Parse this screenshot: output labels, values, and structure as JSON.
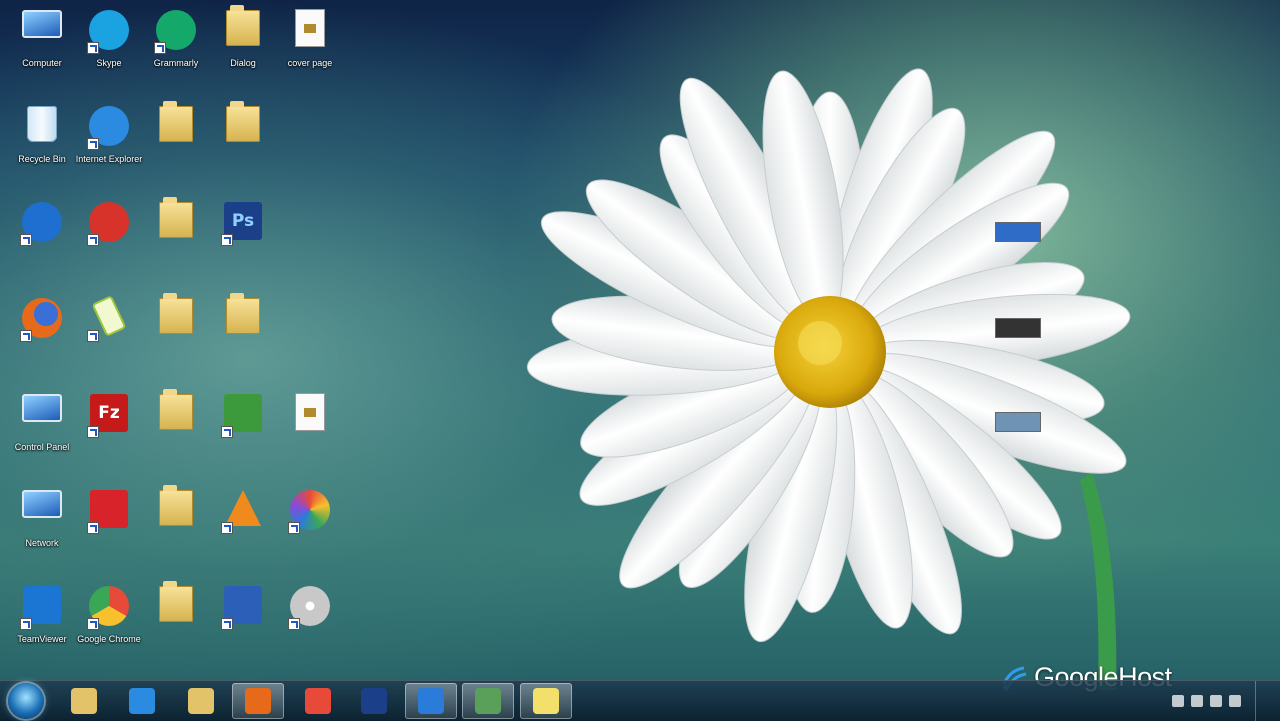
{
  "desktop_icons": [
    {
      "key": "computer",
      "label": "Computer",
      "glyph": "computer-icon",
      "color": "#2b7bd8"
    },
    {
      "key": "skype",
      "label": "Skype",
      "glyph": "skype-icon",
      "color": "#1aa3e0"
    },
    {
      "key": "grammarly",
      "label": "Grammarly",
      "glyph": "grammarly-icon",
      "color": "#14a86a"
    },
    {
      "key": "dialog",
      "label": "Dialog",
      "glyph": "folder-icon",
      "color": "#e2c36a"
    },
    {
      "key": "cover-page",
      "label": "cover page",
      "glyph": "document-icon",
      "color": "#f4f4f4"
    },
    {
      "key": "recycle-bin",
      "label": "Recycle Bin",
      "glyph": "recycle-bin-icon",
      "color": "#cfe6f5"
    },
    {
      "key": "ie-alt",
      "label": "Internet Explorer",
      "glyph": "ie-icon",
      "color": "#2a8be0"
    },
    {
      "key": "folder-b",
      "label": "",
      "glyph": "folder-icon",
      "color": "#e2c36a"
    },
    {
      "key": "folder-c",
      "label": "",
      "glyph": "folder-icon",
      "color": "#e2c36a"
    },
    {
      "key": "thunder",
      "label": "",
      "glyph": "lightning-icon",
      "color": "#1f6fd0"
    },
    {
      "key": "ccleaner",
      "label": "",
      "glyph": "ccleaner-icon",
      "color": "#d8332a"
    },
    {
      "key": "folder-d",
      "label": "",
      "glyph": "folder-icon",
      "color": "#e2c36a"
    },
    {
      "key": "photoshop",
      "label": "",
      "glyph": "photoshop-icon",
      "color": "#1c3f8a"
    },
    {
      "key": "firefox",
      "label": "",
      "glyph": "firefox-icon",
      "color": "#e66a1a"
    },
    {
      "key": "phone-app",
      "label": "",
      "glyph": "phone-icon",
      "color": "#9bc53d"
    },
    {
      "key": "folder-e",
      "label": "",
      "glyph": "folder-icon",
      "color": "#e2c36a"
    },
    {
      "key": "folder-f",
      "label": "",
      "glyph": "folder-icon",
      "color": "#e2c36a"
    },
    {
      "key": "control-panel",
      "label": "Control Panel",
      "glyph": "control-panel-icon",
      "color": "#4da6e8"
    },
    {
      "key": "filezilla",
      "label": "",
      "glyph": "filezilla-icon",
      "color": "#c41a1a"
    },
    {
      "key": "folder-g",
      "label": "",
      "glyph": "folder-icon",
      "color": "#e2c36a"
    },
    {
      "key": "spreadsheet",
      "label": "",
      "glyph": "spreadsheet-icon",
      "color": "#3c9a3c"
    },
    {
      "key": "doc-b",
      "label": "",
      "glyph": "document-icon",
      "color": "#f4f4f4"
    },
    {
      "key": "network",
      "label": "Network",
      "glyph": "network-icon",
      "color": "#2b7bd8"
    },
    {
      "key": "ftp-app",
      "label": "",
      "glyph": "ftp-app-icon",
      "color": "#d8232a"
    },
    {
      "key": "folder-h",
      "label": "",
      "glyph": "folder-icon",
      "color": "#e2c36a"
    },
    {
      "key": "vlc",
      "label": "",
      "glyph": "vlc-icon",
      "color": "#f08a1c"
    },
    {
      "key": "picasa",
      "label": "",
      "glyph": "picasa-icon",
      "color": "#8a4bd8"
    },
    {
      "key": "teamviewer",
      "label": "TeamViewer",
      "glyph": "teamviewer-icon",
      "color": "#1a76d2"
    },
    {
      "key": "chrome",
      "label": "Google Chrome",
      "glyph": "chrome-icon",
      "color": "#e84a3a"
    },
    {
      "key": "folder-i",
      "label": "",
      "glyph": "folder-icon",
      "color": "#e2c36a"
    },
    {
      "key": "app-blue",
      "label": "",
      "glyph": "app-icon",
      "color": "#2b5fb8"
    },
    {
      "key": "app-disk",
      "label": "",
      "glyph": "disk-icon",
      "color": "#d9d9d9"
    }
  ],
  "right_files": [
    {
      "key": "rf1",
      "label": "",
      "thumb": "#2e6cc8"
    },
    {
      "key": "rf2",
      "label": "",
      "thumb": "#333333"
    },
    {
      "key": "rf3",
      "label": "",
      "thumb": "#6f93b5"
    }
  ],
  "watermark": {
    "text": "GoogleHost"
  },
  "taskbar": {
    "apps": [
      {
        "key": "start",
        "label": "",
        "icon": "start-icon",
        "color": "#1a6fb6"
      },
      {
        "key": "library",
        "label": "",
        "icon": "library-icon",
        "color": "#e2c36a"
      },
      {
        "key": "internet-explorer",
        "label": "",
        "icon": "ie-icon",
        "color": "#2a8be0"
      },
      {
        "key": "explorer",
        "label": "",
        "icon": "folder-icon",
        "color": "#e2c36a"
      },
      {
        "key": "firefox",
        "label": "",
        "icon": "firefox-icon",
        "color": "#e66a1a"
      },
      {
        "key": "chrome",
        "label": "",
        "icon": "chrome-icon",
        "color": "#e84a3a"
      },
      {
        "key": "photoshop",
        "label": "",
        "icon": "photoshop-icon",
        "color": "#1c3f8a"
      },
      {
        "key": "network-tool",
        "label": "",
        "icon": "network-icon",
        "color": "#2b7bd8"
      },
      {
        "key": "paint",
        "label": "",
        "icon": "paint-icon",
        "color": "#5aa05a"
      },
      {
        "key": "notes",
        "label": "",
        "icon": "notes-icon",
        "color": "#f2e06a"
      }
    ],
    "clock_time": "",
    "clock_date": ""
  }
}
